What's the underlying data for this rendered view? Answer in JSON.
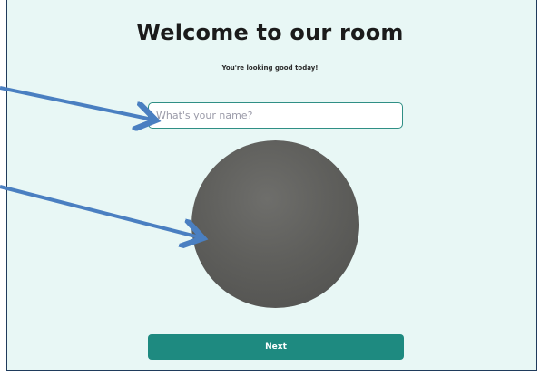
{
  "header": {
    "title": "Welcome to our room",
    "subtitle": "You're looking good today!"
  },
  "name_field": {
    "placeholder": "What's your name?",
    "value": ""
  },
  "avatar": {
    "icon": "camera-preview"
  },
  "actions": {
    "next_label": "Next"
  },
  "colors": {
    "background": "#e8f7f5",
    "accent": "#1e8a80",
    "annotation_arrow": "#4a7fc1"
  }
}
